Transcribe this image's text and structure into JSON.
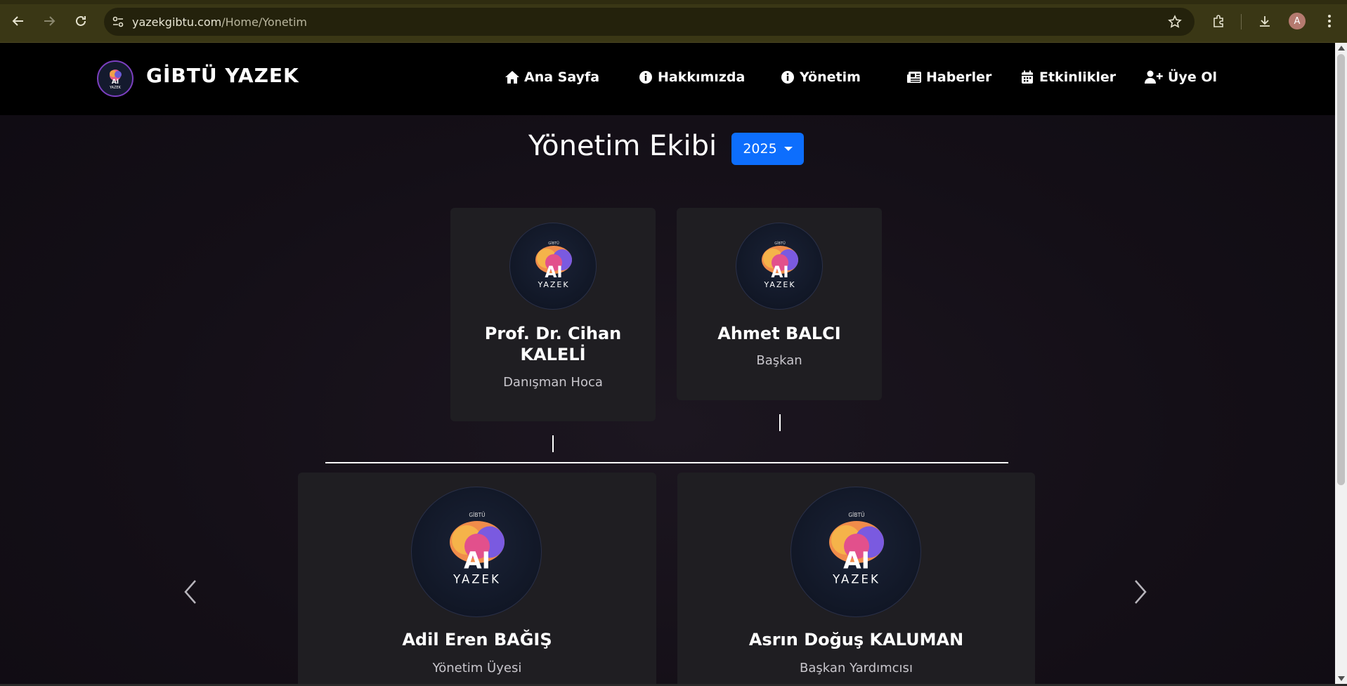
{
  "browser": {
    "url_host": "yazekgibtu.com",
    "url_path": "/Home/Yonetim",
    "profile_initial": "A"
  },
  "site": {
    "brand": "GİBTÜ YAZEK",
    "logo_text": "AI",
    "logo_sub": "YAZEK",
    "nav": [
      {
        "label": "Ana Sayfa",
        "icon": "home-icon"
      },
      {
        "label": "Hakkımızda",
        "icon": "info-icon"
      },
      {
        "label": "Yönetim",
        "icon": "info-icon"
      },
      {
        "label": "Haberler",
        "icon": "newspaper-icon"
      },
      {
        "label": "Etkinlikler",
        "icon": "calendar-icon"
      },
      {
        "label": "Üye Ol",
        "icon": "user-plus-icon"
      }
    ]
  },
  "main": {
    "title": "Yönetim Ekibi",
    "year": "2025",
    "members_top": [
      {
        "name": "Prof. Dr. Cihan KALELİ",
        "role": "Danışman Hoca"
      },
      {
        "name": "Ahmet BALCI",
        "role": "Başkan"
      }
    ],
    "members_bottom": [
      {
        "name": "Adil Eren BAĞIŞ",
        "role": "Yönetim Üyesi"
      },
      {
        "name": "Asrın Doğuş KALUMAN",
        "role": "Başkan Yardımcısı"
      }
    ],
    "photo_text": {
      "top": "GİBTÜ",
      "main": "AI",
      "sub": "YAZEK"
    }
  },
  "colors": {
    "accent": "#0d6efd",
    "navbar": "#000000",
    "card": "#1f1e22"
  }
}
